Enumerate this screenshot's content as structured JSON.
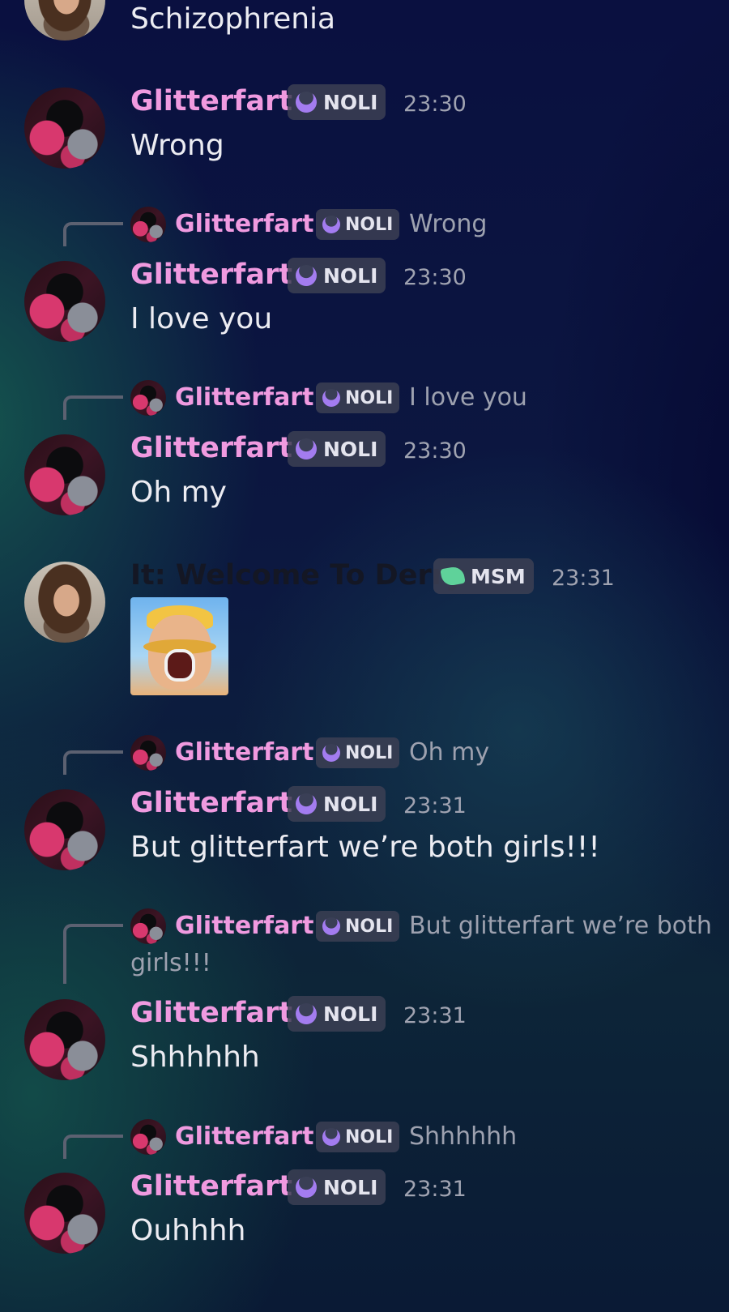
{
  "colors": {
    "username": "#f09ae0",
    "timestamp": "#a0a3b1",
    "reply_text": "#9da1af",
    "tag_bg": "#3c4054",
    "noli_icon": "#a37cf0",
    "msm_icon": "#5fd29a"
  },
  "messages": [
    {
      "text": "Schizophrenia"
    },
    {
      "author": "Glitterfart",
      "tag": "NOLI",
      "time": "23:30",
      "text": "Wrong"
    },
    {
      "reply": {
        "author": "Glitterfart",
        "tag": "NOLI",
        "text": "Wrong"
      },
      "author": "Glitterfart",
      "tag": "NOLI",
      "time": "23:30",
      "text": "I love you"
    },
    {
      "reply": {
        "author": "Glitterfart",
        "tag": "NOLI",
        "text": "I love you"
      },
      "author": "Glitterfart",
      "tag": "NOLI",
      "time": "23:30",
      "text": "Oh my"
    },
    {
      "author": "It: Welcome To Derry",
      "tag": "MSM",
      "time": "23:31",
      "image_icon": "barbarian-face-image"
    },
    {
      "reply": {
        "author": "Glitterfart",
        "tag": "NOLI",
        "text": "Oh my"
      },
      "author": "Glitterfart",
      "tag": "NOLI",
      "time": "23:31",
      "text": "But glitterfart we’re both girls!!!"
    },
    {
      "reply": {
        "author": "Glitterfart",
        "tag": "NOLI",
        "text": "But glitterfart we’re both",
        "text_line2": "girls!!!"
      },
      "author": "Glitterfart",
      "tag": "NOLI",
      "time": "23:31",
      "text": "Shhhhhh"
    },
    {
      "reply": {
        "author": "Glitterfart",
        "tag": "NOLI",
        "text": "Shhhhhh"
      },
      "author": "Glitterfart",
      "tag": "NOLI",
      "time": "23:31",
      "text": "Ouhhhh"
    }
  ]
}
